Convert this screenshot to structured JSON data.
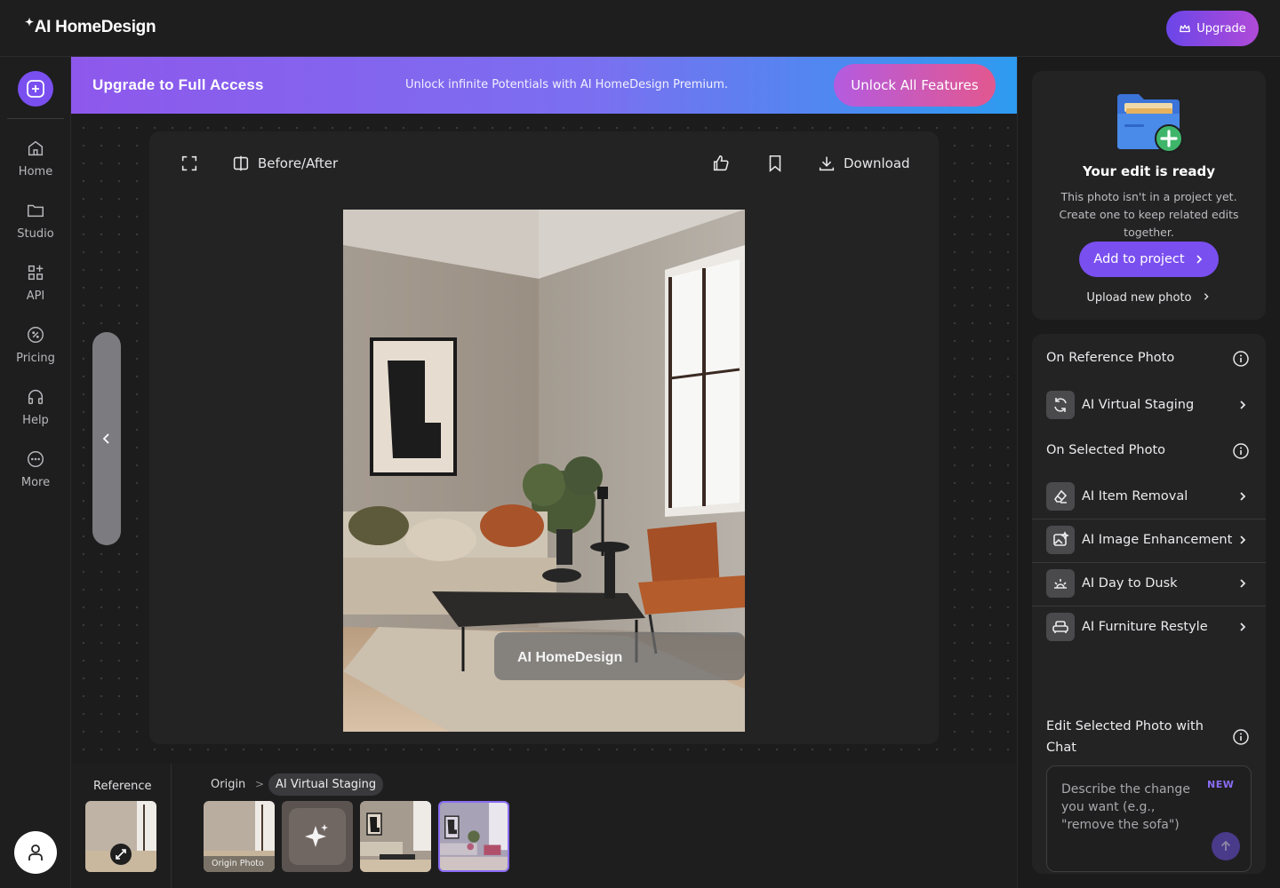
{
  "app": {
    "logo_text": "AI HomeDesign",
    "upgrade_label": "Upgrade"
  },
  "nav": {
    "items": [
      {
        "label": "Home",
        "icon": "home-icon"
      },
      {
        "label": "Studio",
        "icon": "folder-icon"
      },
      {
        "label": "API",
        "icon": "api-grid-icon"
      },
      {
        "label": "Pricing",
        "icon": "pricing-percent-icon"
      },
      {
        "label": "Help",
        "icon": "headphones-icon"
      },
      {
        "label": "More",
        "icon": "more-dots-icon"
      }
    ]
  },
  "banner": {
    "title": "Upgrade to Full Access",
    "subtitle": "Unlock infinite Potentials with AI HomeDesign Premium.",
    "cta": "Unlock All Features"
  },
  "viewer": {
    "before_after_label": "Before/After",
    "download_label": "Download",
    "watermark": "AI HomeDesign"
  },
  "bottom": {
    "reference_label": "Reference",
    "breadcrumb": {
      "origin": "Origin",
      "separator": ">",
      "active": "AI Virtual Staging"
    },
    "origin_thumb_label": "Origin Photo"
  },
  "ready_card": {
    "title": "Your edit is ready",
    "description": "This photo isn't in a project yet. Create one to keep related edits together.",
    "add_button": "Add to project",
    "upload_link": "Upload new photo"
  },
  "tools": {
    "reference_heading": "On Reference Photo",
    "reference_tools": [
      {
        "label": "AI Virtual Staging",
        "icon": "refresh-cycle-icon"
      }
    ],
    "selected_heading": "On Selected Photo",
    "selected_tools": [
      {
        "label": "AI Item Removal",
        "icon": "eraser-icon"
      },
      {
        "label": "AI Image Enhancement",
        "icon": "image-sparkle-icon"
      },
      {
        "label": "AI Day to Dusk",
        "icon": "sunset-icon"
      },
      {
        "label": "AI Furniture Restyle",
        "icon": "sofa-icon"
      }
    ],
    "chat_heading": "Edit Selected Photo with Chat",
    "chat_placeholder": "Describe the change you want (e.g., \"remove the sofa\")",
    "chat_badge": "NEW"
  },
  "colors": {
    "accent": "#7a4ff0",
    "banner_start": "#8e58ec",
    "banner_end": "#2d9bf0"
  }
}
